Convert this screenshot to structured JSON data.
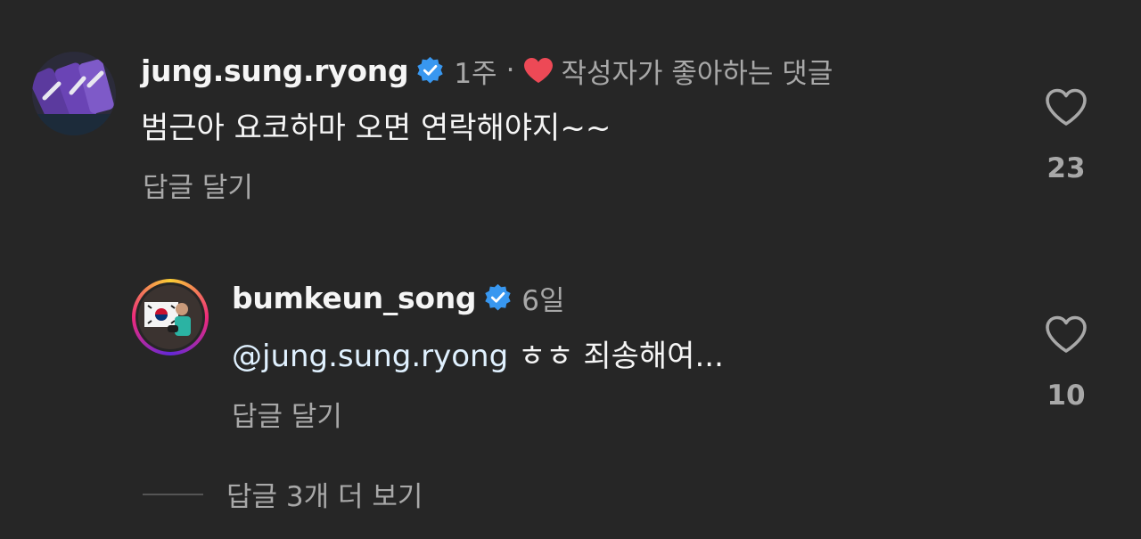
{
  "comments": [
    {
      "username": "jung.sung.ryong",
      "time": "1주",
      "author_liked_label": "작성자가 좋아하는 댓글",
      "text": "범근아 요코하마 오면  연락해야지~~",
      "reply_label": "답글 달기",
      "likes": "23",
      "icons": [
        "verified-badge-icon",
        "heart-icon"
      ]
    },
    {
      "username": "bumkeun_song",
      "time": "6일",
      "mention": "@jung.sung.ryong",
      "text": " ㅎㅎ 죄송해여...",
      "reply_label": "답글 달기",
      "likes": "10",
      "icons": [
        "verified-badge-icon",
        "heart-icon"
      ]
    }
  ],
  "more_replies_label": "답글 3개 더 보기",
  "colors": {
    "background": "#262626",
    "text": "#f5f5f5",
    "muted": "#a8a8a8",
    "verified": "#3897f0",
    "author_heart": "#ed4956"
  }
}
